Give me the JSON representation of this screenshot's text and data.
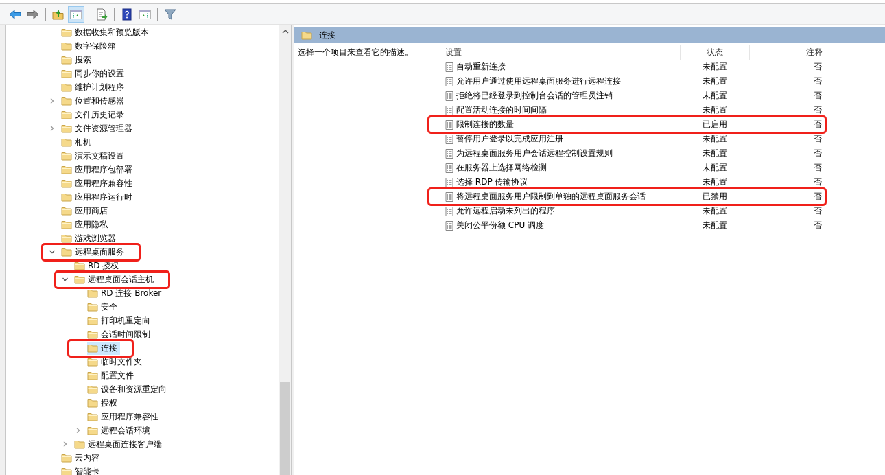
{
  "toolbar": [
    {
      "kind": "back",
      "pressed": false
    },
    {
      "kind": "forward",
      "pressed": false
    },
    {
      "kind": "separator"
    },
    {
      "kind": "up",
      "pressed": false
    },
    {
      "kind": "tree-toggle",
      "pressed": true
    },
    {
      "kind": "separator"
    },
    {
      "kind": "export",
      "pressed": false
    },
    {
      "kind": "separator"
    },
    {
      "kind": "help",
      "pressed": false
    },
    {
      "kind": "panel-toggle",
      "pressed": false
    },
    {
      "kind": "separator"
    },
    {
      "kind": "filter",
      "pressed": false
    }
  ],
  "tree": [
    {
      "label": "数据收集和预览版本",
      "selected": false,
      "annotated": false
    },
    {
      "label": "数字保险箱",
      "selected": false,
      "annotated": false
    },
    {
      "label": "搜索",
      "selected": false,
      "annotated": false
    },
    {
      "label": "同步你的设置",
      "selected": false,
      "annotated": false
    },
    {
      "label": "维护计划程序",
      "selected": false,
      "annotated": false
    },
    {
      "label": "位置和传感器",
      "selected": false,
      "annotated": false,
      "expanded": false
    },
    {
      "label": "文件历史记录",
      "selected": false,
      "annotated": false
    },
    {
      "label": "文件资源管理器",
      "selected": false,
      "annotated": false,
      "expanded": false
    },
    {
      "label": "相机",
      "selected": false,
      "annotated": false
    },
    {
      "label": "演示文稿设置",
      "selected": false,
      "annotated": false
    },
    {
      "label": "应用程序包部署",
      "selected": false,
      "annotated": false
    },
    {
      "label": "应用程序兼容性",
      "selected": false,
      "annotated": false
    },
    {
      "label": "应用程序运行时",
      "selected": false,
      "annotated": false
    },
    {
      "label": "应用商店",
      "selected": false,
      "annotated": false
    },
    {
      "label": "应用隐私",
      "selected": false,
      "annotated": false
    },
    {
      "label": "游戏浏览器",
      "selected": false,
      "annotated": false
    },
    {
      "label": "远程桌面服务",
      "selected": false,
      "annotated": true,
      "expanded": true,
      "children": [
        {
          "label": "RD 授权",
          "selected": false,
          "annotated": false
        },
        {
          "label": "远程桌面会话主机",
          "selected": false,
          "annotated": true,
          "expanded": true,
          "children": [
            {
              "label": "RD 连接 Broker",
              "selected": false,
              "annotated": false
            },
            {
              "label": "安全",
              "selected": false,
              "annotated": false
            },
            {
              "label": "打印机重定向",
              "selected": false,
              "annotated": false
            },
            {
              "label": "会话时间限制",
              "selected": false,
              "annotated": false
            },
            {
              "label": "连接",
              "selected": true,
              "annotated": true
            },
            {
              "label": "临时文件夹",
              "selected": false,
              "annotated": false
            },
            {
              "label": "配置文件",
              "selected": false,
              "annotated": false
            },
            {
              "label": "设备和资源重定向",
              "selected": false,
              "annotated": false
            },
            {
              "label": "授权",
              "selected": false,
              "annotated": false
            },
            {
              "label": "应用程序兼容性",
              "selected": false,
              "annotated": false
            },
            {
              "label": "远程会话环境",
              "selected": false,
              "annotated": false,
              "expanded": false
            }
          ]
        },
        {
          "label": "远程桌面连接客户端",
          "selected": false,
          "annotated": false,
          "expanded": false
        }
      ]
    },
    {
      "label": "云内容",
      "selected": false,
      "annotated": false
    },
    {
      "label": "智能卡",
      "selected": false,
      "annotated": false
    }
  ],
  "details": {
    "title": "连接",
    "description": "选择一个项目来查看它的描述。"
  },
  "table": {
    "columns": [
      "设置",
      "状态",
      "注释"
    ],
    "rows": [
      {
        "setting": "自动重新连接",
        "state": "未配置",
        "comment": "否",
        "annotated": false
      },
      {
        "setting": "允许用户通过使用远程桌面服务进行远程连接",
        "state": "未配置",
        "comment": "否",
        "annotated": false
      },
      {
        "setting": "拒绝将已经登录到控制台会话的管理员注销",
        "state": "未配置",
        "comment": "否",
        "annotated": false
      },
      {
        "setting": "配置活动连接的时间间隔",
        "state": "未配置",
        "comment": "否",
        "annotated": false
      },
      {
        "setting": "限制连接的数量",
        "state": "已启用",
        "comment": "否",
        "annotated": true
      },
      {
        "setting": "暂停用户登录以完成应用注册",
        "state": "未配置",
        "comment": "否",
        "annotated": false
      },
      {
        "setting": "为远程桌面服务用户会话远程控制设置规则",
        "state": "未配置",
        "comment": "否",
        "annotated": false
      },
      {
        "setting": "在服务器上选择网络检测",
        "state": "未配置",
        "comment": "否",
        "annotated": false
      },
      {
        "setting": "选择 RDP 传输协议",
        "state": "未配置",
        "comment": "否",
        "annotated": false
      },
      {
        "setting": "将远程桌面服务用户限制到单独的远程桌面服务会话",
        "state": "已禁用",
        "comment": "否",
        "annotated": true
      },
      {
        "setting": "允许远程启动未列出的程序",
        "state": "未配置",
        "comment": "否",
        "annotated": false
      },
      {
        "setting": "关闭公平份额 CPU 调度",
        "state": "未配置",
        "comment": "否",
        "annotated": false
      }
    ]
  }
}
